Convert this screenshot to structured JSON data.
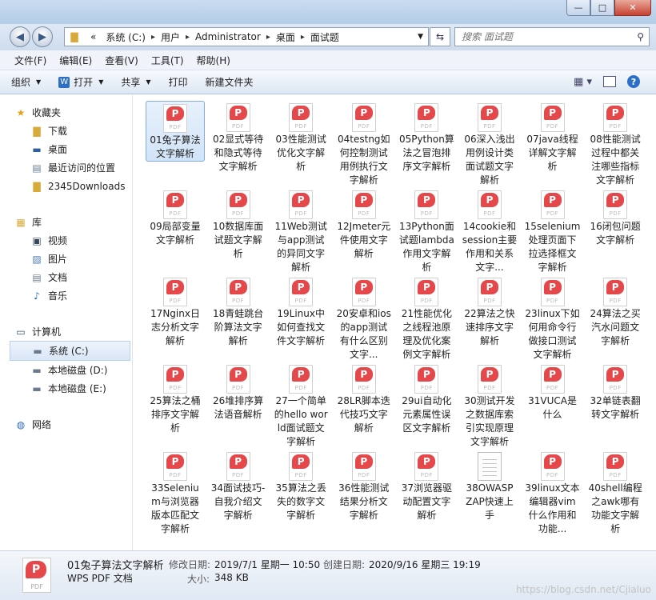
{
  "address": {
    "breadcrumbs": [
      "«",
      "系统 (C:)",
      "用户",
      "Administrator",
      "桌面",
      "面试题"
    ],
    "search_placeholder": "搜索 面试题"
  },
  "window_buttons": {
    "minimize": "—",
    "maximize": "□",
    "close": "✕"
  },
  "menu": [
    "文件(F)",
    "编辑(E)",
    "查看(V)",
    "工具(T)",
    "帮助(H)"
  ],
  "toolbar": {
    "organize": "组织",
    "open": "打开",
    "share": "共享",
    "print": "打印",
    "new_folder": "新建文件夹"
  },
  "sidebar": {
    "favorites": {
      "label": "收藏夹",
      "items": [
        "下载",
        "桌面",
        "最近访问的位置",
        "2345Downloads"
      ]
    },
    "library": {
      "label": "库",
      "items": [
        "视频",
        "图片",
        "文档",
        "音乐"
      ]
    },
    "computer": {
      "label": "计算机",
      "items": [
        "系统 (C:)",
        "本地磁盘 (D:)",
        "本地磁盘 (E:)"
      ]
    },
    "network": {
      "label": "网络"
    }
  },
  "files": [
    {
      "name": "01兔子算法文字解析",
      "type": "pdf"
    },
    {
      "name": "02显式等待和隐式等待文字解析",
      "type": "pdf"
    },
    {
      "name": "03性能测试优化文字解析",
      "type": "pdf"
    },
    {
      "name": "04testng如何控制测试用例执行文字解析",
      "type": "pdf"
    },
    {
      "name": "05Python算法之冒泡排序文字解析",
      "type": "pdf"
    },
    {
      "name": "06深入浅出用例设计类面试题文字解析",
      "type": "pdf"
    },
    {
      "name": "07java线程详解文字解析",
      "type": "pdf"
    },
    {
      "name": "08性能测试过程中都关注哪些指标文字解析",
      "type": "pdf"
    },
    {
      "name": "09局部变量文字解析",
      "type": "pdf"
    },
    {
      "name": "10数据库面试题文字解析",
      "type": "pdf"
    },
    {
      "name": "11Web测试与app测试的异同文字解析",
      "type": "pdf"
    },
    {
      "name": "12Jmeter元件使用文字解析",
      "type": "pdf"
    },
    {
      "name": "13Python面试题lambda作用文字解析",
      "type": "pdf"
    },
    {
      "name": "14cookie和session主要作用和关系文字...",
      "type": "pdf"
    },
    {
      "name": "15selenium处理页面下拉选择框文字解析",
      "type": "pdf"
    },
    {
      "name": "16闭包问题文字解析",
      "type": "pdf"
    },
    {
      "name": "17Nginx日志分析文字解析",
      "type": "pdf"
    },
    {
      "name": "18青蛙跳台阶算法文字解析",
      "type": "pdf"
    },
    {
      "name": "19Linux中如何查找文件文字解析",
      "type": "pdf"
    },
    {
      "name": "20安卓和ios的app测试有什么区别文字...",
      "type": "pdf"
    },
    {
      "name": "21性能优化之线程池原理及优化案例文字解析",
      "type": "pdf"
    },
    {
      "name": "22算法之快速排序文字解析",
      "type": "pdf"
    },
    {
      "name": "23linux下如何用命令行做接口测试文字解析",
      "type": "pdf"
    },
    {
      "name": "24算法之买汽水问题文字解析",
      "type": "pdf"
    },
    {
      "name": "25算法之桶排序文字解析",
      "type": "pdf"
    },
    {
      "name": "26堆排序算法语音解析",
      "type": "pdf"
    },
    {
      "name": "27一个简单的hello world面试题文字解析",
      "type": "pdf"
    },
    {
      "name": "28LR脚本迭代技巧文字解析",
      "type": "pdf"
    },
    {
      "name": "29ui自动化元素属性误区文字解析",
      "type": "pdf"
    },
    {
      "name": "30测试开发之数据库索引实现原理文字解析",
      "type": "pdf"
    },
    {
      "name": "31VUCA是什么",
      "type": "pdf"
    },
    {
      "name": "32单链表翻转文字解析",
      "type": "pdf"
    },
    {
      "name": "33Selenium与浏览器版本匹配文字解析",
      "type": "pdf"
    },
    {
      "name": "34面试技巧-自我介绍文字解析",
      "type": "pdf"
    },
    {
      "name": "35算法之丢失的数字文字解析",
      "type": "pdf"
    },
    {
      "name": "36性能测试结果分析文字解析",
      "type": "pdf"
    },
    {
      "name": "37浏览器驱动配置文字解析",
      "type": "pdf"
    },
    {
      "name": "38OWASP ZAP快速上手",
      "type": "doc"
    },
    {
      "name": "39linux文本编辑器vim什么作用和功能...",
      "type": "pdf"
    },
    {
      "name": "40shell编程之awk哪有功能文字解析",
      "type": "pdf"
    }
  ],
  "status": {
    "file_name": "01兔子算法文字解析",
    "file_type": "WPS PDF 文档",
    "modified_label": "修改日期:",
    "modified_value": "2019/7/1 星期一 10:50",
    "created_label": "创建日期:",
    "created_value": "2020/9/16 星期三 19:19",
    "size_label": "大小:",
    "size_value": "348 KB"
  },
  "watermark": "https://blog.csdn.net/Cjialuo",
  "colors": {
    "accent": "#2b6fc7",
    "pdf_red": "#e5484a",
    "selection": "#d1e3f8"
  }
}
